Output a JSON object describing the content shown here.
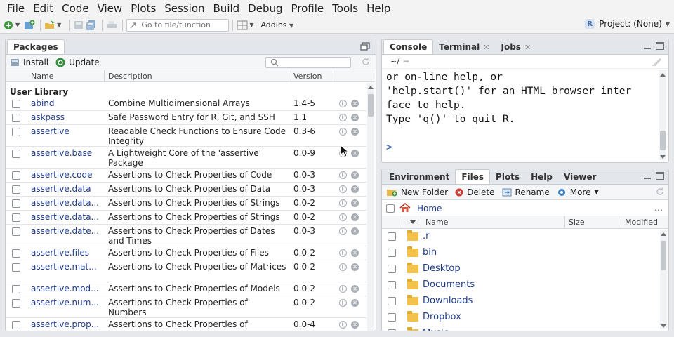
{
  "menu": [
    "File",
    "Edit",
    "Code",
    "View",
    "Plots",
    "Session",
    "Build",
    "Debug",
    "Profile",
    "Tools",
    "Help"
  ],
  "toolbar": {
    "goto_placeholder": "Go to file/function",
    "addins_label": "Addins",
    "project_label": "Project: (None)"
  },
  "packages_pane": {
    "tab": "Packages",
    "install_label": "Install",
    "update_label": "Update",
    "columns": [
      "Name",
      "Description",
      "Version"
    ],
    "group_label": "User Library",
    "rows": [
      {
        "name": "abind",
        "desc": "Combine Multidimensional Arrays",
        "ver": "1.4-5"
      },
      {
        "name": "askpass",
        "desc": "Safe Password Entry for R, Git, and SSH",
        "ver": "1.1"
      },
      {
        "name": "assertive",
        "desc": "Readable Check Functions to Ensure Code Integrity",
        "ver": "0.3-6"
      },
      {
        "name": "assertive.base",
        "desc": "A Lightweight Core of the 'assertive' Package",
        "ver": "0.0-9"
      },
      {
        "name": "assertive.code",
        "desc": "Assertions to Check Properties of Code",
        "ver": "0.0-3"
      },
      {
        "name": "assertive.data",
        "desc": "Assertions to Check Properties of Data",
        "ver": "0.0-3"
      },
      {
        "name": "assertive.data...",
        "desc": "Assertions to Check Properties of Strings",
        "ver": "0.0-2"
      },
      {
        "name": "assertive.data...",
        "desc": "Assertions to Check Properties of Strings",
        "ver": "0.0-2"
      },
      {
        "name": "assertive.date...",
        "desc": "Assertions to Check Properties of Dates and Times",
        "ver": "0.0-3"
      },
      {
        "name": "assertive.files",
        "desc": "Assertions to Check Properties of Files",
        "ver": "0.0-2"
      },
      {
        "name": "assertive.mat...",
        "desc": "Assertions to Check Properties of Matrices",
        "ver": "0.0-2"
      },
      {
        "name": "assertive.mod...",
        "desc": "Assertions to Check Properties of Models",
        "ver": "0.0-2"
      },
      {
        "name": "assertive.num...",
        "desc": "Assertions to Check Properties of Numbers",
        "ver": "0.0-2"
      },
      {
        "name": "assertive.prop...",
        "desc": "Assertions to Check Properties of",
        "ver": "0.0-4"
      }
    ]
  },
  "console_pane": {
    "tabs": [
      {
        "label": "Console",
        "closable": false
      },
      {
        "label": "Terminal",
        "closable": true
      },
      {
        "label": "Jobs",
        "closable": true
      }
    ],
    "path": "~/",
    "lines": [
      "or on-line help, or",
      "'help.start()' for an HTML browser inter",
      "face to help.",
      "Type 'q()' to quit R."
    ],
    "prompt": ">"
  },
  "files_pane": {
    "tabs": [
      "Environment",
      "Files",
      "Plots",
      "Help",
      "Viewer"
    ],
    "active_tab": "Files",
    "new_folder_label": "New Folder",
    "delete_label": "Delete",
    "rename_label": "Rename",
    "more_label": "More",
    "home_label": "Home",
    "columns": [
      "Name",
      "Size",
      "Modified"
    ],
    "items": [
      ".r",
      "bin",
      "Desktop",
      "Documents",
      "Downloads",
      "Dropbox",
      "Music"
    ]
  }
}
